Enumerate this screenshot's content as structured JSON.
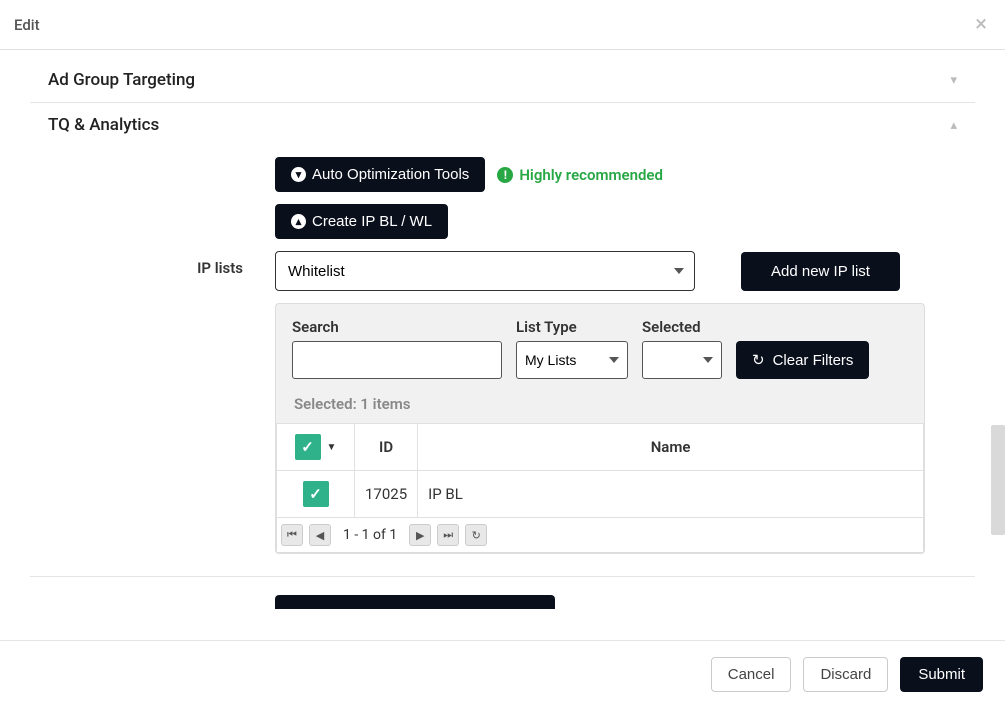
{
  "modal": {
    "title": "Edit"
  },
  "accordion": {
    "ad_group_targeting": "Ad Group Targeting",
    "tq_analytics": "TQ & Analytics"
  },
  "buttons": {
    "auto_opt": "Auto Optimization Tools",
    "create_ip": "Create IP BL / WL",
    "add_list": "Add new IP list",
    "clear_filters": "Clear Filters"
  },
  "badge": {
    "highly_recommended": "Highly recommended"
  },
  "labels": {
    "ip_lists": "IP lists",
    "search": "Search",
    "list_type": "List Type",
    "selected": "Selected"
  },
  "selects": {
    "whitelist": "Whitelist",
    "my_lists": "My Lists"
  },
  "summary": {
    "selected_items": "Selected: 1 items"
  },
  "table": {
    "headers": {
      "id": "ID",
      "name": "Name"
    },
    "rows": [
      {
        "id": "17025",
        "name": "IP BL"
      }
    ]
  },
  "pager": {
    "text": "1 - 1 of 1"
  },
  "footer": {
    "cancel": "Cancel",
    "discard": "Discard",
    "submit": "Submit"
  }
}
